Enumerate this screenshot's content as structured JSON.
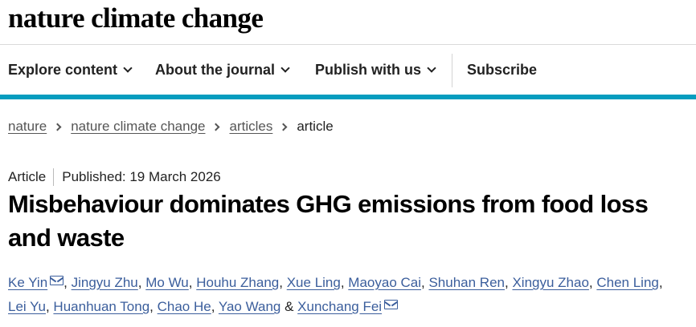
{
  "site": {
    "logo": "nature climate change"
  },
  "nav": {
    "items": [
      {
        "label": "Explore content",
        "dropdown": true
      },
      {
        "label": "About the journal",
        "dropdown": true
      },
      {
        "label": "Publish with us",
        "dropdown": true
      },
      {
        "label": "Subscribe",
        "dropdown": false
      }
    ]
  },
  "breadcrumb": {
    "links": [
      "nature",
      "nature climate change",
      "articles"
    ],
    "current": "article"
  },
  "article": {
    "type": "Article",
    "published": "Published: 19 March 2026",
    "title": "Misbehaviour dominates GHG emissions from food loss and waste",
    "authors": [
      {
        "name": "Ke Yin",
        "email": true
      },
      {
        "name": "Jingyu Zhu"
      },
      {
        "name": "Mo Wu"
      },
      {
        "name": "Houhu Zhang"
      },
      {
        "name": "Xue Ling"
      },
      {
        "name": "Maoyao Cai"
      },
      {
        "name": "Shuhan Ren"
      },
      {
        "name": "Xingyu Zhao"
      },
      {
        "name": "Chen Ling"
      },
      {
        "name": "Lei Yu"
      },
      {
        "name": "Huanhuan Tong"
      },
      {
        "name": "Chao He"
      },
      {
        "name": "Yao Wang"
      },
      {
        "name": "Xunchang Fei",
        "email": true
      }
    ],
    "author_separator": ", ",
    "author_final_separator": " & "
  },
  "colors": {
    "accent_bar": "#069dbf",
    "author_link": "#3b5e9c",
    "text": "#222222"
  },
  "icons": {
    "nav_dropdown": "chevron-down-icon",
    "breadcrumb_separator": "chevron-right-icon",
    "author_contact": "mail-icon"
  }
}
